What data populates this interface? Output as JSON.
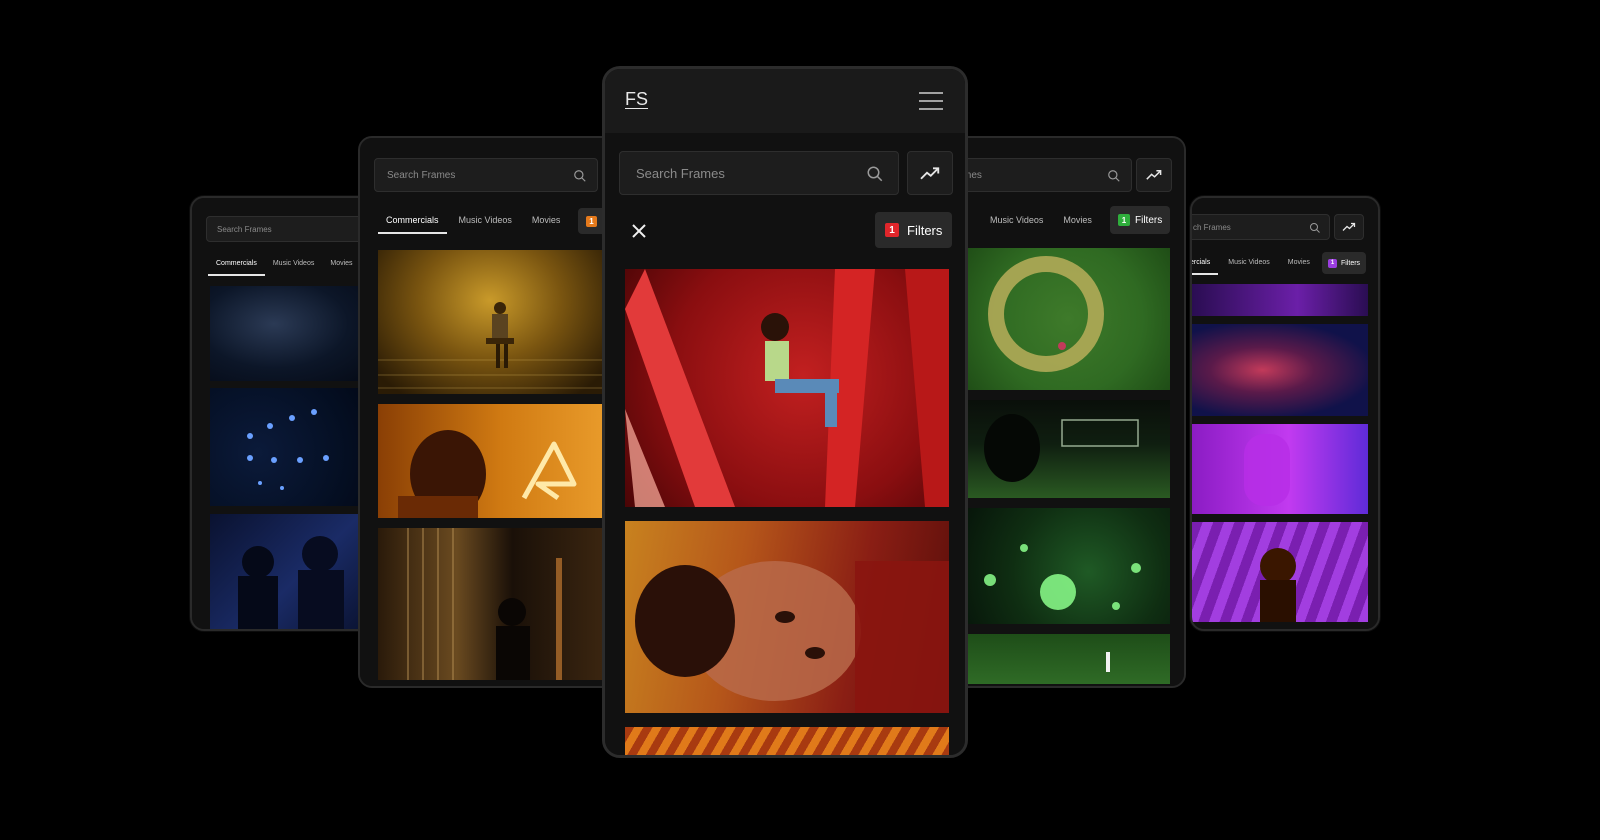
{
  "app": {
    "logo": "FS"
  },
  "search": {
    "placeholder": "Search Frames",
    "partial_left": "Search Frames",
    "partial_right_mid": "mes",
    "partial_right_far": "ch Frames"
  },
  "tabs": {
    "commercials": "Commercials",
    "music_videos": "Music Videos",
    "movies": "Movies",
    "partial_right_far": "ercials"
  },
  "filters": {
    "label": "Filters",
    "count_center": "1",
    "count_left": "1",
    "count_right_mid": "1",
    "count_right_far": "1"
  },
  "colors": {
    "background": "#000000",
    "panel": "#161616",
    "badge_red": "#e0262b",
    "badge_orange": "#e57a1c",
    "badge_green": "#2fae3c",
    "badge_purple": "#9b3ee0"
  },
  "icons": {
    "search": "magnifier",
    "trending": "trend-up-arrow",
    "menu": "hamburger",
    "close": "x"
  }
}
